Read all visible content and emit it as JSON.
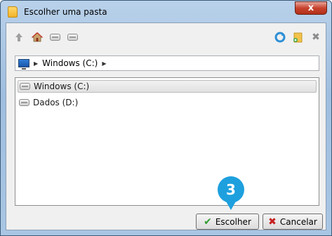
{
  "window": {
    "title": "Escolher uma pasta",
    "close_label": "x"
  },
  "toolbar": {
    "icons": [
      "up-arrow-icon",
      "home-icon",
      "drive-icon",
      "drive-icon",
      "refresh-icon",
      "new-folder-icon",
      "delete-icon"
    ]
  },
  "pathbar": {
    "segment": "Windows (C:)"
  },
  "list": {
    "items": [
      {
        "label": "Windows (C:)",
        "selected": true
      },
      {
        "label": "Dados (D:)",
        "selected": false
      }
    ]
  },
  "buttons": {
    "choose_label": "Escolher",
    "cancel_label": "Cancelar"
  },
  "annotation": {
    "step": "3"
  },
  "colors": {
    "accent": "#1ea0de",
    "title_gradient": "#b9d1ea",
    "close_red": "#c7422c"
  }
}
